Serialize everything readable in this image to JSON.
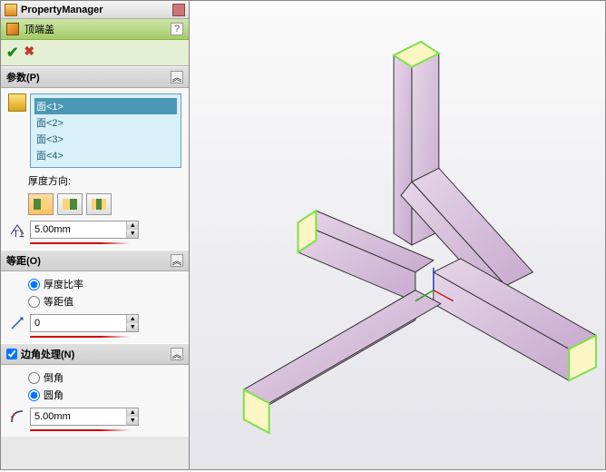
{
  "header": {
    "title": "PropertyManager"
  },
  "feature": {
    "name": "顶端盖",
    "help": "?"
  },
  "buttons": {
    "ok": "✔",
    "cancel": "✖"
  },
  "params": {
    "title": "参数(P)",
    "faces": [
      "面<1>",
      "面<2>",
      "面<3>",
      "面<4>"
    ],
    "thickness_dir_label": "厚度方向:",
    "thickness_value": "5.00mm"
  },
  "offset": {
    "title": "等距(O)",
    "opt_ratio": "厚度比率",
    "opt_value": "等距值",
    "value": "0"
  },
  "corner": {
    "title": "边角处理(N)",
    "opt_chamfer": "倒角",
    "opt_fillet": "圆角",
    "value": "5.00mm"
  },
  "chevron": "︽"
}
